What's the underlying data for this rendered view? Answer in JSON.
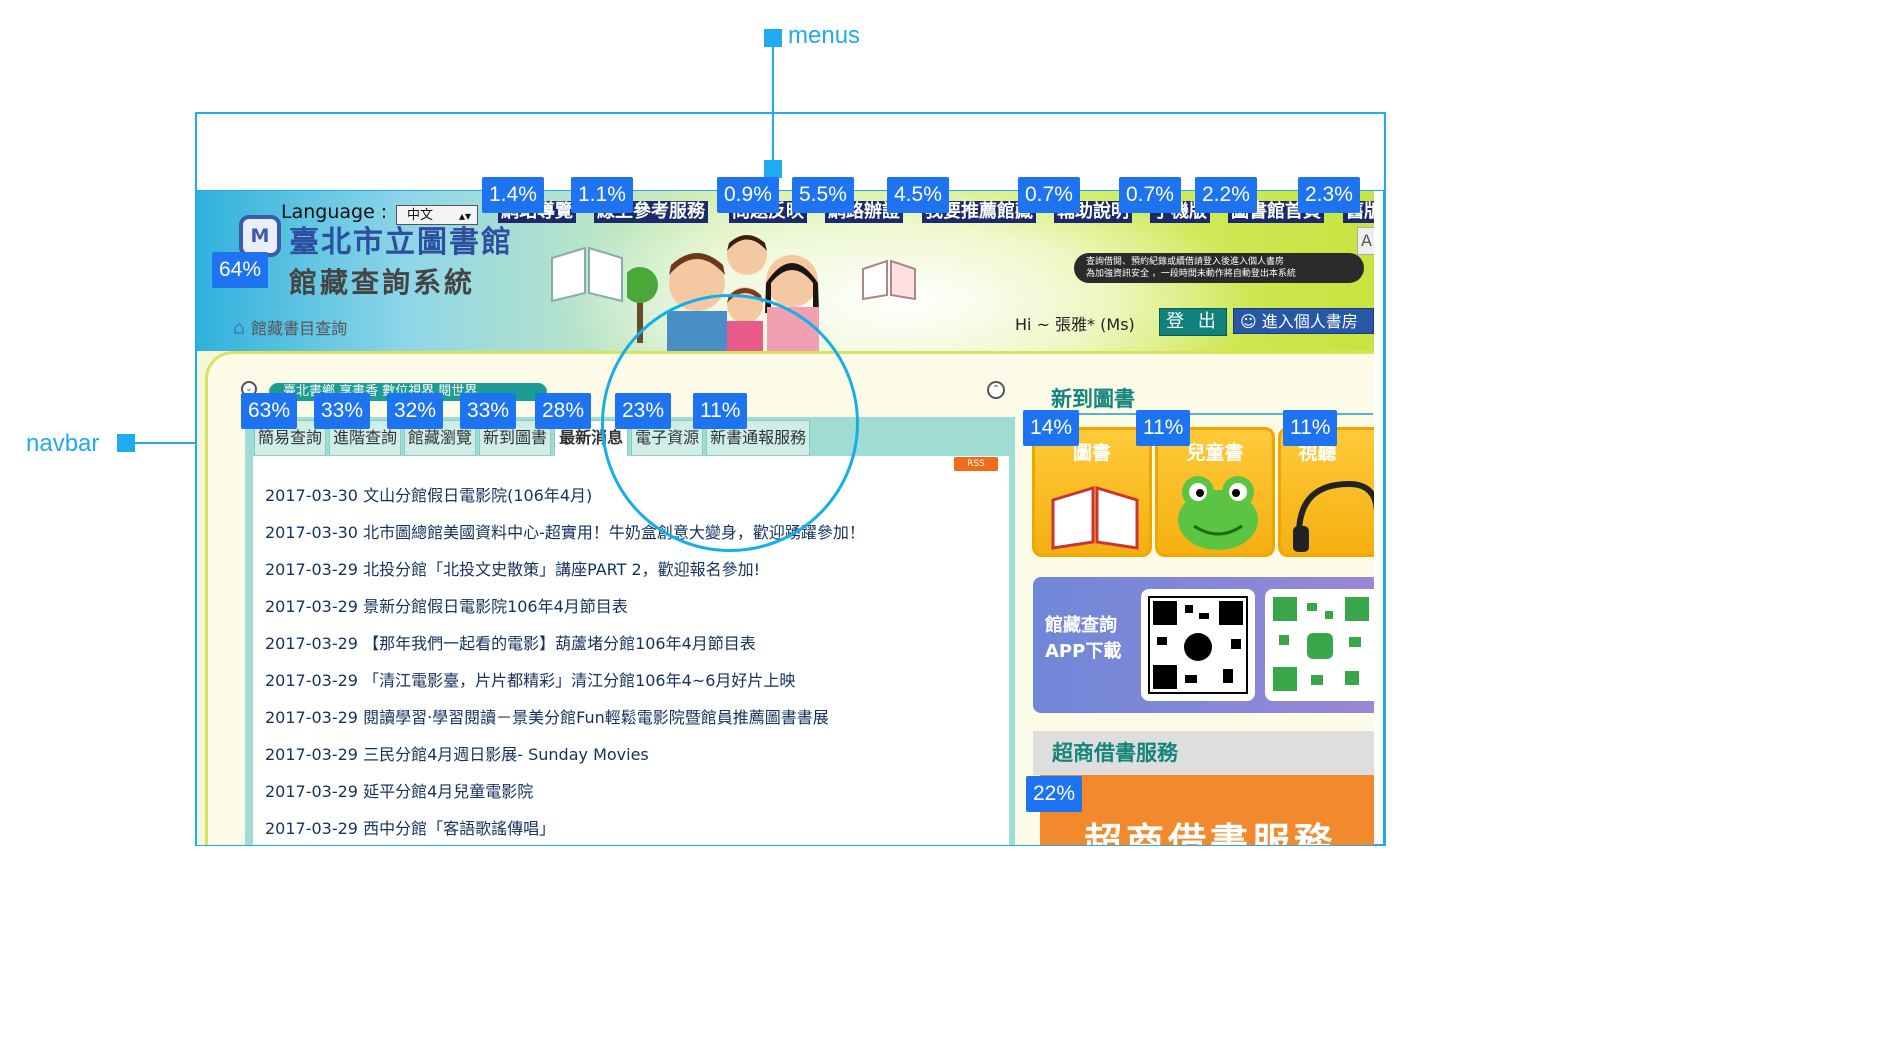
{
  "annotations": {
    "menus_label": "menus",
    "navbar_label": "navbar"
  },
  "header": {
    "language_label": "Language :",
    "language_value": "中文",
    "menus": [
      "網站導覽",
      "線上參考服務",
      "問題反映",
      "網路辦證",
      "我要推薦館藏",
      "輔助說明",
      "手機版",
      "圖書館首頁",
      "舊版"
    ],
    "logo_mark": "M",
    "logo_title": "臺北市立圖書館",
    "logo_subtitle": "館藏查詢系統",
    "breadcrumb": "館藏書目查詢",
    "notice_line1": "查詢借閱、預約紀錄或續借請登入後進入個人書房",
    "notice_line2": "為加強資訊安全 ，一段時間未動作將自動登出本系統",
    "greeting": "Hi ~ 張雅* (Ms)",
    "logout_label": "登 出",
    "personal_room_label": "進入個人書房"
  },
  "menu_percentages": [
    "1.4%",
    "1.1%",
    "0.9%",
    "5.5%",
    "4.5%",
    "0.7%",
    "0.7%",
    "2.2%",
    "2.3%"
  ],
  "logo_percentage": "64%",
  "tab_percentages": [
    "63%",
    "33%",
    "32%",
    "33%",
    "28%",
    "23%",
    "11%"
  ],
  "category_percentages": [
    "14%",
    "11%",
    "11%"
  ],
  "shop_percentage": "22%",
  "content": {
    "banner": "臺北書鄉 享書香 數位視界 閱世界",
    "tabs": [
      "簡易查詢",
      "進階查詢",
      "館藏瀏覽",
      "新到圖書",
      "最新消息",
      "電子資源",
      "新書通報服務"
    ],
    "active_tab": "最新消息",
    "rss_label": "RSS",
    "news": [
      "2017-03-30 文山分館假日電影院(106年4月)",
      "2017-03-30 北市圖總館美國資料中心-超實用！牛奶盒創意大變身，歡迎踴躍參加！",
      "2017-03-29 北投分館「北投文史散策」講座PART 2，歡迎報名參加!",
      "2017-03-29 景新分館假日電影院106年4月節目表",
      "2017-03-29 【那年我們一起看的電影】葫蘆堵分館106年4月節目表",
      "2017-03-29 「清江電影臺，片片都精彩」清江分館106年4~6月好片上映",
      "2017-03-29 閱讀學習‧學習閱讀－景美分館Fun輕鬆電影院暨館員推薦圖書書展",
      "2017-03-29 三民分館4月週日影展- Sunday Movies",
      "2017-03-29 延平分館4月兒童電影院",
      "2017-03-29 西中分館「客語歌謠傳唱」"
    ]
  },
  "sidebar": {
    "new_books_title": "新到圖書",
    "categories": [
      "圖書",
      "兒童書",
      "視聽"
    ],
    "app_line1": "館藏查詢",
    "app_line2": "APP下載",
    "shop_title": "超商借書服務",
    "shop_banner": "超商借書服務"
  },
  "colors": {
    "annotation": "#20aaf0",
    "badge": "#1e74f0",
    "brand_teal": "#14857d",
    "brand_blue": "#2e4fa0"
  }
}
